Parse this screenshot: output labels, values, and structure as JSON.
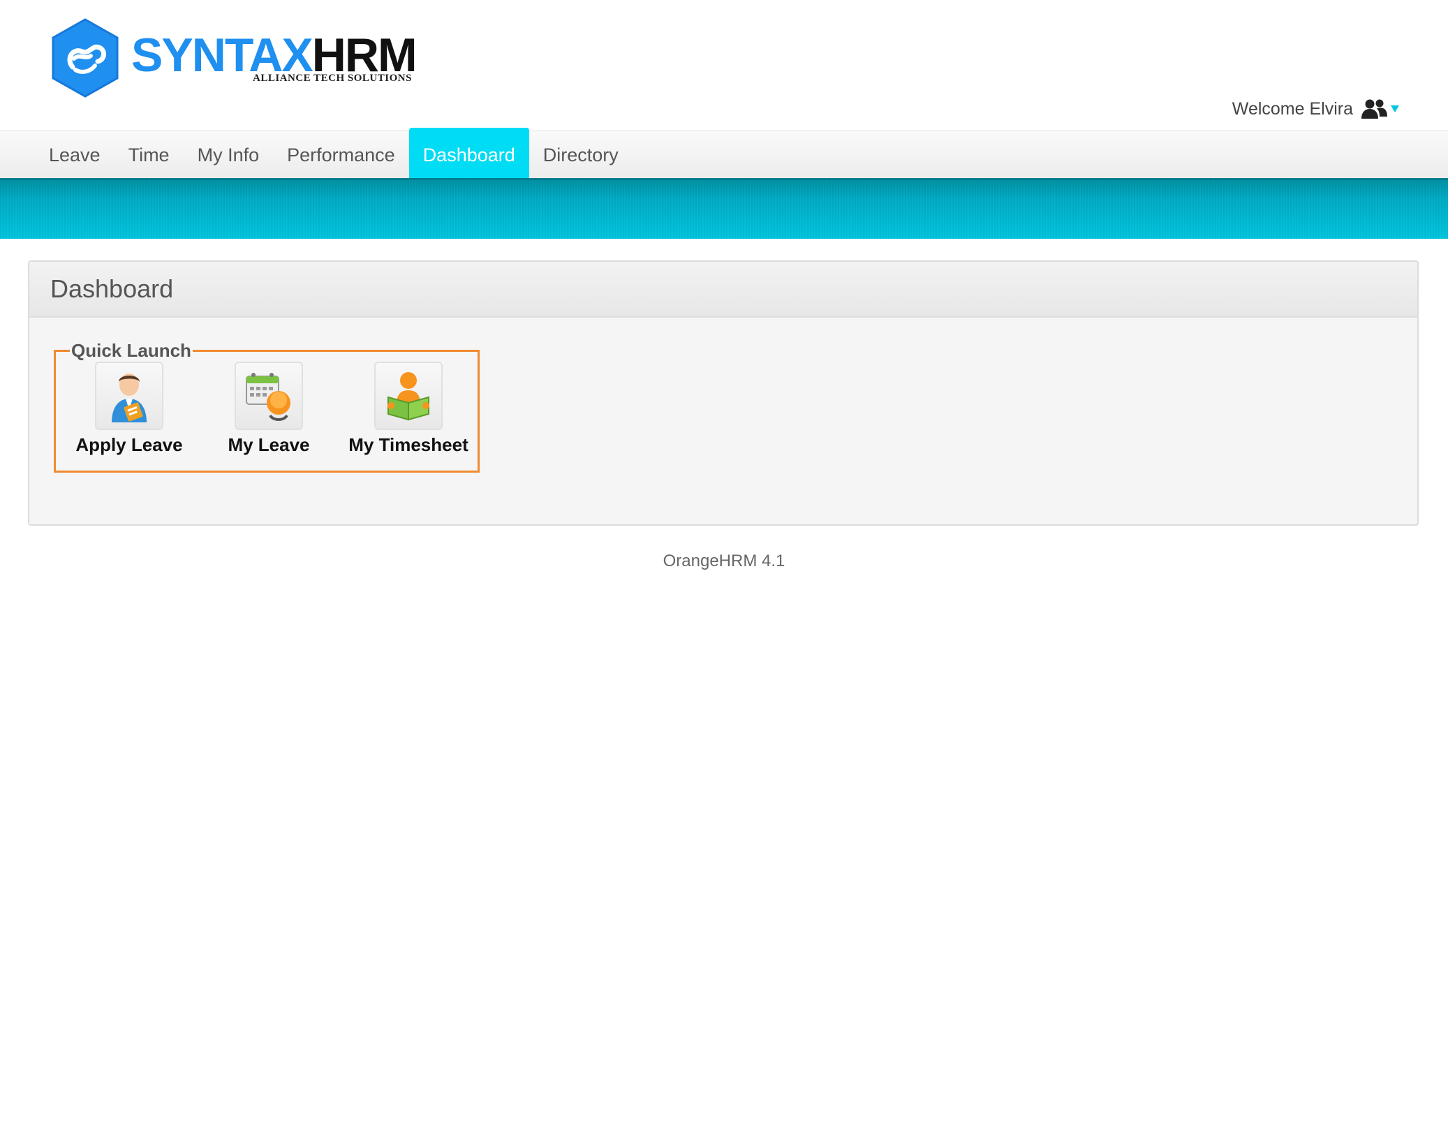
{
  "branding": {
    "logo_brand": "SYNTAX",
    "logo_suffix": "HRM",
    "logo_tagline": "ALLIANCE TECH SOLUTIONS",
    "brand_color": "#1f8ff0"
  },
  "header": {
    "welcome_text": "Welcome Elvira",
    "user_icon": "users-icon",
    "menu_icon": "caret-down-icon"
  },
  "nav": {
    "items": [
      {
        "label": "Leave",
        "active": false
      },
      {
        "label": "Time",
        "active": false
      },
      {
        "label": "My Info",
        "active": false
      },
      {
        "label": "Performance",
        "active": false
      },
      {
        "label": "Dashboard",
        "active": true
      },
      {
        "label": "Directory",
        "active": false
      }
    ],
    "active_color": "#00dcf4"
  },
  "dashboard": {
    "title": "Dashboard",
    "quick_launch": {
      "legend": "Quick Launch",
      "border_color": "#f08a30",
      "items": [
        {
          "label": "Apply Leave",
          "icon": "apply-leave-icon"
        },
        {
          "label": "My Leave",
          "icon": "my-leave-icon"
        },
        {
          "label": "My Timesheet",
          "icon": "my-timesheet-icon"
        }
      ]
    }
  },
  "footer": {
    "text": "OrangeHRM 4.1"
  }
}
